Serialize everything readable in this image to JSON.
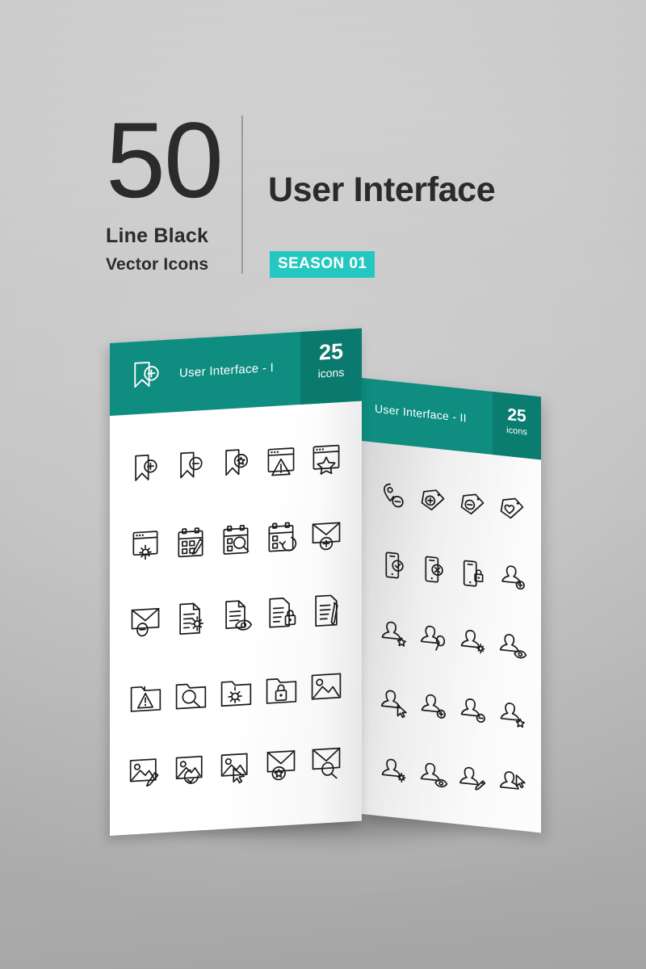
{
  "headline": {
    "count": "50",
    "style_line1": "Line Black",
    "style_line2": "Vector Icons",
    "title": "User Interface",
    "season_badge": "SEASON 01"
  },
  "colors": {
    "background": "#c8c8c8",
    "band_teal": "#0e8d80",
    "band_teal_dark": "#0a7a6e",
    "badge_turquoise": "#25c8c0",
    "text_dark": "#2b2b2b",
    "icon_stroke": "#1a1a1a",
    "divider": "#9a9a9a"
  },
  "panels": [
    {
      "id": "panel-one",
      "band_icon": "bookmark-add-icon",
      "title": "User Interface - I",
      "count_number": "25",
      "count_label": "icons",
      "columns": 5,
      "icons": [
        "bookmark-add-icon",
        "bookmark-remove-icon",
        "bookmark-star-icon",
        "browser-warning-icon",
        "browser-star-icon",
        "browser-settings-icon",
        "calendar-edit-icon",
        "calendar-search-icon",
        "calendar-refresh-icon",
        "mail-add-icon",
        "mail-remove-icon",
        "document-settings-icon",
        "document-view-icon",
        "document-lock-icon",
        "document-edit-icon",
        "folder-warning-icon",
        "folder-search-icon",
        "folder-settings-icon",
        "folder-lock-icon",
        "image-icon",
        "image-edit-icon",
        "image-refresh-icon",
        "image-select-icon",
        "mail-star-icon",
        "mail-search-icon"
      ]
    },
    {
      "id": "panel-two",
      "title": "User Interface - II",
      "count_number": "25",
      "count_label": "icons",
      "columns": 4,
      "icons": [
        "location-remove-icon",
        "tag-add-icon",
        "tag-remove-icon",
        "tag-heart-icon",
        "mobile-check-icon",
        "mobile-cancel-icon",
        "mobile-lock-icon",
        "user-add-icon",
        "user-star-icon",
        "user-search-icon",
        "user-settings-icon",
        "user-view-icon",
        "user-cursor-icon",
        "user-plus-icon",
        "user-minus-icon",
        "user-favorite-icon",
        "user-gear-icon",
        "user-eye-icon",
        "user-edit-icon",
        "user-pointer-icon"
      ]
    }
  ]
}
